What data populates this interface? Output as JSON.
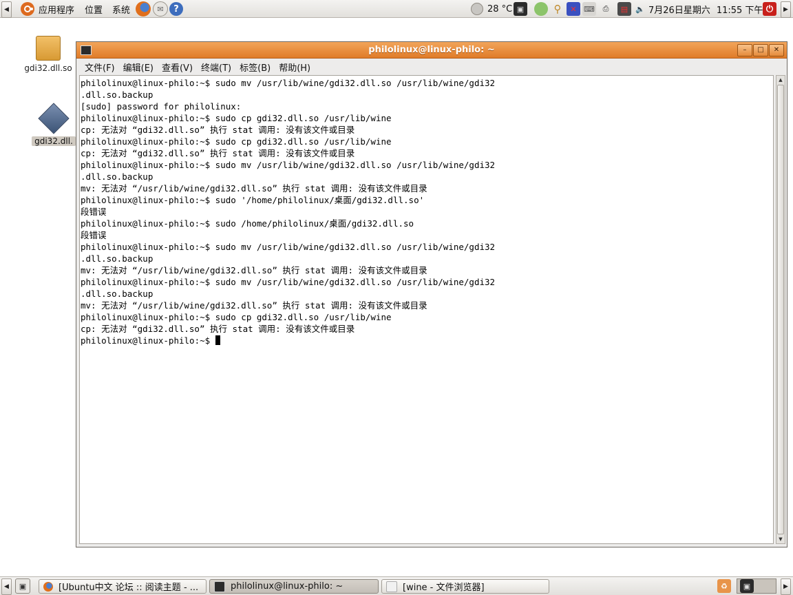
{
  "top_panel": {
    "menus": [
      "应用程序",
      "位置",
      "系统"
    ],
    "temperature": "28 °C",
    "date": "7月26日星期六",
    "time": "11:55 下午"
  },
  "desktop_icons": [
    {
      "label": "gdi32.dll.so"
    },
    {
      "label": "gdi32.dll."
    }
  ],
  "window": {
    "title": "philolinux@linux-philo: ~",
    "menu": [
      "文件(F)",
      "编辑(E)",
      "查看(V)",
      "终端(T)",
      "标签(B)",
      "帮助(H)"
    ],
    "buttons": {
      "minimize": "–",
      "maximize": "□",
      "close": "✕"
    }
  },
  "terminal": {
    "lines": [
      "philolinux@linux-philo:~$ sudo mv /usr/lib/wine/gdi32.dll.so /usr/lib/wine/gdi32",
      ".dll.so.backup",
      "[sudo] password for philolinux:",
      "philolinux@linux-philo:~$ sudo cp gdi32.dll.so /usr/lib/wine",
      "cp: 无法对 “gdi32.dll.so” 执行 stat 调用: 没有该文件或目录",
      "philolinux@linux-philo:~$ sudo cp gdi32.dll.so /usr/lib/wine",
      "cp: 无法对 “gdi32.dll.so” 执行 stat 调用: 没有该文件或目录",
      "philolinux@linux-philo:~$ sudo mv /usr/lib/wine/gdi32.dll.so /usr/lib/wine/gdi32",
      ".dll.so.backup",
      "mv: 无法对 “/usr/lib/wine/gdi32.dll.so” 执行 stat 调用: 没有该文件或目录",
      "philolinux@linux-philo:~$ sudo '/home/philolinux/桌面/gdi32.dll.so'",
      "段错误",
      "philolinux@linux-philo:~$ sudo /home/philolinux/桌面/gdi32.dll.so",
      "段错误",
      "philolinux@linux-philo:~$ sudo mv /usr/lib/wine/gdi32.dll.so /usr/lib/wine/gdi32",
      ".dll.so.backup",
      "mv: 无法对 “/usr/lib/wine/gdi32.dll.so” 执行 stat 调用: 没有该文件或目录",
      "philolinux@linux-philo:~$ sudo mv /usr/lib/wine/gdi32.dll.so /usr/lib/wine/gdi32",
      ".dll.so.backup",
      "mv: 无法对 “/usr/lib/wine/gdi32.dll.so” 执行 stat 调用: 没有该文件或目录",
      "philolinux@linux-philo:~$ sudo cp gdi32.dll.so /usr/lib/wine",
      "cp: 无法对 “gdi32.dll.so” 执行 stat 调用: 没有该文件或目录"
    ],
    "prompt": "philolinux@linux-philo:~$ "
  },
  "taskbar": {
    "items": [
      {
        "label": "[Ubuntu中文 论坛 :: 阅读主题 - ...",
        "icon": "firefox-icon",
        "active": false
      },
      {
        "label": "philolinux@linux-philo: ~",
        "icon": "terminal-icon",
        "active": true
      },
      {
        "label": "[wine - 文件浏览器]",
        "icon": "file-browser-icon",
        "active": false
      }
    ]
  },
  "colors": {
    "titlebar": "#e07b28",
    "panel": "#e8e6e2",
    "terminal_bg": "#ffffff"
  }
}
